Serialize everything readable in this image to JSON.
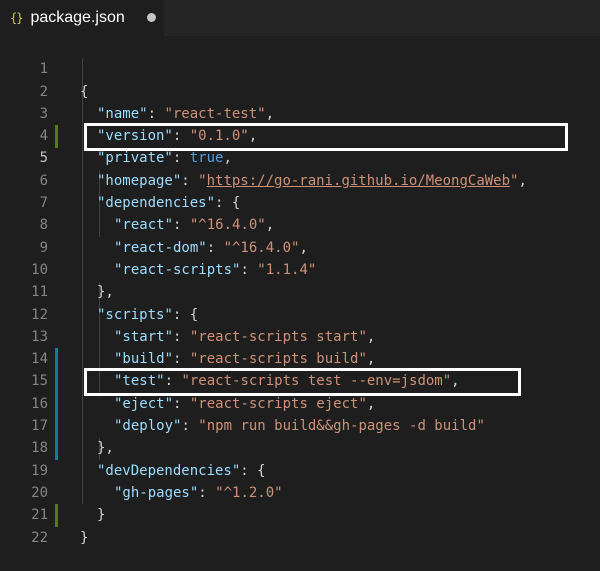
{
  "tab": {
    "icon": "{}",
    "title": "package.json",
    "dirty_icon": "modified-dot-icon"
  },
  "lines": [
    {
      "n": "1"
    },
    {
      "n": "2"
    },
    {
      "n": "3"
    },
    {
      "n": "4"
    },
    {
      "n": "5"
    },
    {
      "n": "6"
    },
    {
      "n": "7"
    },
    {
      "n": "8"
    },
    {
      "n": "9"
    },
    {
      "n": "10"
    },
    {
      "n": "11"
    },
    {
      "n": "12"
    },
    {
      "n": "13"
    },
    {
      "n": "14"
    },
    {
      "n": "15"
    },
    {
      "n": "16"
    },
    {
      "n": "17"
    },
    {
      "n": "18"
    },
    {
      "n": "19"
    },
    {
      "n": "20"
    },
    {
      "n": "21"
    },
    {
      "n": "22"
    }
  ],
  "code": {
    "open_brace": "{",
    "name_key": "\"name\"",
    "name_val": "\"react-test\"",
    "version_key": "\"version\"",
    "version_val": "\"0.1.0\"",
    "private_key": "\"private\"",
    "private_val": "true",
    "homepage_key": "\"homepage\"",
    "homepage_q1": "\"",
    "homepage_url": "https://go-rani.github.io/MeongCaWeb",
    "homepage_q2": "\"",
    "deps_key": "\"dependencies\"",
    "react_key": "\"react\"",
    "react_val": "\"^16.4.0\"",
    "reactdom_key": "\"react-dom\"",
    "reactdom_val": "\"^16.4.0\"",
    "reactscripts_key": "\"react-scripts\"",
    "reactscripts_val": "\"1.1.4\"",
    "close_obj_comma": "},",
    "scripts_key": "\"scripts\"",
    "start_key": "\"start\"",
    "start_val": "\"react-scripts start\"",
    "build_key": "\"build\"",
    "build_val": "\"react-scripts build\"",
    "test_key": "\"test\"",
    "test_val": "\"react-scripts test --env=jsdom\"",
    "eject_key": "\"eject\"",
    "eject_val": "\"react-scripts eject\"",
    "deploy_key": "\"deploy\"",
    "deploy_val": "\"npm run build&&gh-pages -d build\"",
    "devdeps_key": "\"devDependencies\"",
    "ghpages_key": "\"gh-pages\"",
    "ghpages_val": "\"^1.2.0\"",
    "close_inner": "}",
    "close_brace": "}"
  },
  "colors": {
    "background": "#1e1e1e",
    "key": "#9cdcfe",
    "string": "#ce9178",
    "boolean": "#569cd6",
    "punctuation": "#d4d4d4",
    "line_number": "#858585",
    "gutter_added": "#587c0c",
    "gutter_modified": "#0c7d9d",
    "highlight_box": "#ffffff"
  }
}
